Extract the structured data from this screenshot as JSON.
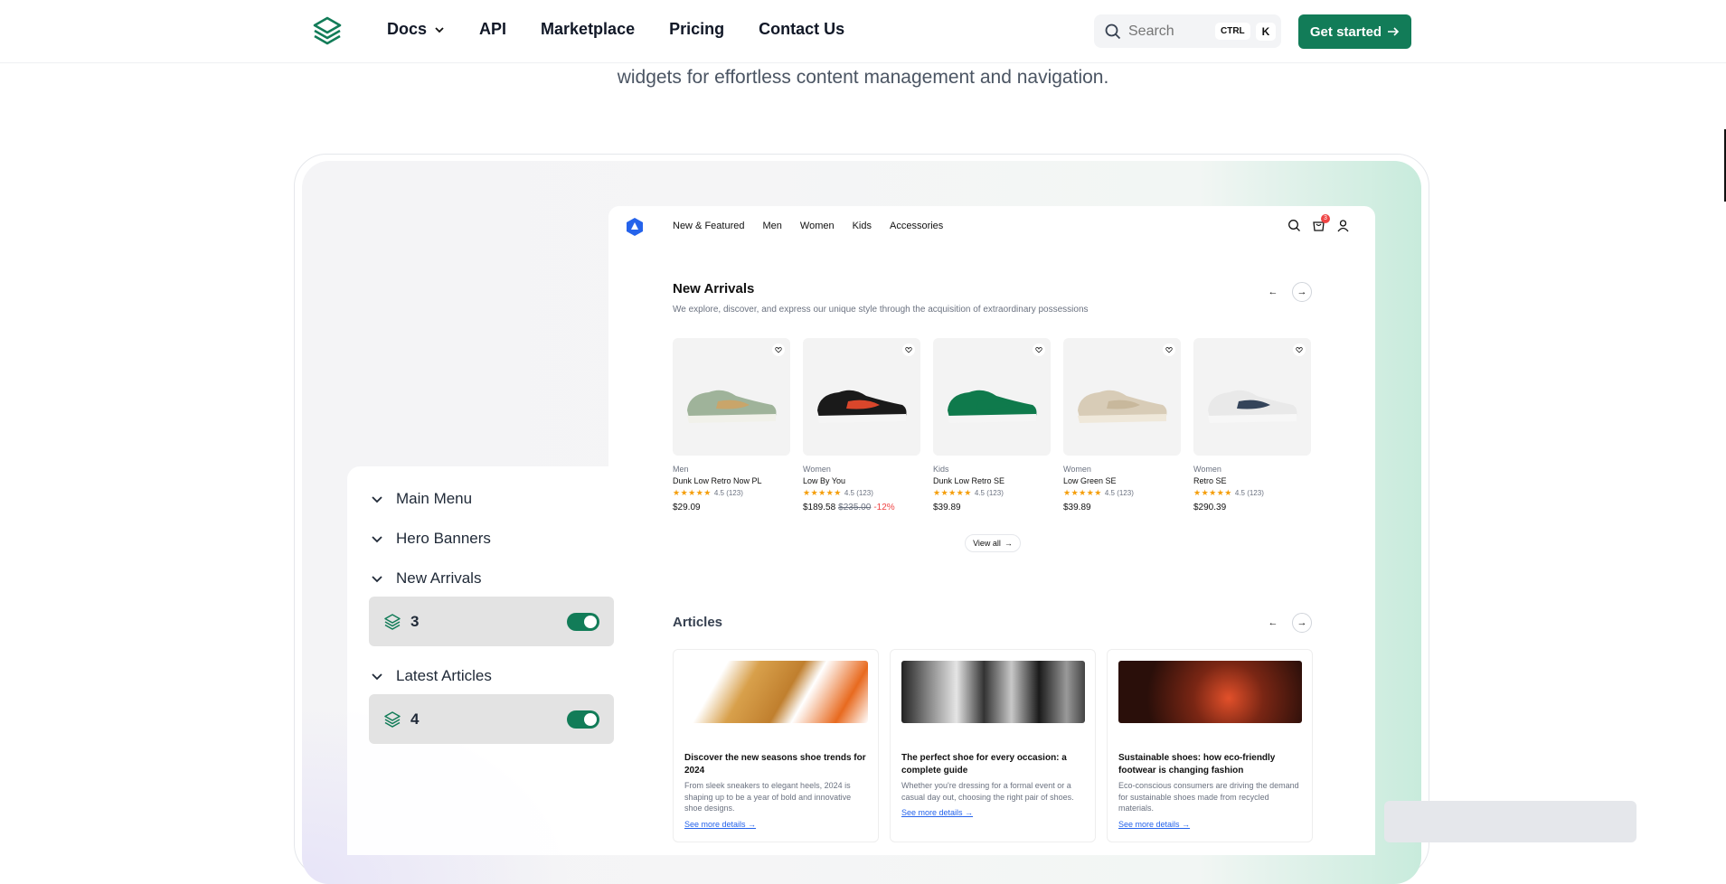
{
  "nav": {
    "links": [
      "Docs",
      "API",
      "Marketplace",
      "Pricing",
      "Contact Us"
    ],
    "search_placeholder": "Search",
    "kbd_ctrl": "CTRL",
    "kbd_k": "K",
    "cta": "Get started"
  },
  "hero": {
    "subtitle": "widgets for effortless content management and navigation."
  },
  "shop": {
    "nav": [
      "New & Featured",
      "Men",
      "Women",
      "Kids",
      "Accessories"
    ],
    "cart_count": "3",
    "new_arrivals": {
      "title": "New Arrivals",
      "subtitle": "We explore, discover, and express our unique style through the acquisition of extraordinary possessions",
      "view_all": "View all",
      "products": [
        {
          "category": "Men",
          "name": "Dunk Low Retro Now PL",
          "rating": "4.5 (123)",
          "price": "$29.09",
          "old_price": "",
          "discount": "",
          "colors": [
            "#9fb39a",
            "#f1f1ea",
            "#c9a56a"
          ]
        },
        {
          "category": "Women",
          "name": "Low By You",
          "rating": "4.5 (123)",
          "price": "$189.58",
          "old_price": "$235.00",
          "discount": "-12%",
          "colors": [
            "#1a1a1a",
            "#f5f5f5",
            "#d9462b"
          ]
        },
        {
          "category": "Kids",
          "name": "Dunk Low Retro SE",
          "rating": "4.5 (123)",
          "price": "$39.89",
          "old_price": "",
          "discount": "",
          "colors": [
            "#0f7a4c",
            "#f5f5f5",
            "#0f7a4c"
          ]
        },
        {
          "category": "Women",
          "name": "Low Green SE",
          "rating": "4.5 (123)",
          "price": "$39.89",
          "old_price": "",
          "discount": "",
          "colors": [
            "#d8ccb7",
            "#efe8da",
            "#c8b89c"
          ]
        },
        {
          "category": "Women",
          "name": "Retro SE",
          "rating": "4.5 (123)",
          "price": "$290.39",
          "old_price": "",
          "discount": "",
          "colors": [
            "#e9e9e9",
            "#f7f7f7",
            "#34445a"
          ]
        }
      ]
    },
    "articles": {
      "title": "Articles",
      "items": [
        {
          "title": "Discover the new seasons shoe trends for 2024",
          "text": "From sleek sneakers to elegant heels, 2024 is shaping up to be a year of bold and innovative shoe designs.",
          "link": "See more details",
          "img_color": "#d8a04b"
        },
        {
          "title": "The perfect shoe for every occasion: a complete guide",
          "text": "Whether you're dressing for a formal event or a casual day out, choosing the right pair of shoes.",
          "link": "See more details",
          "img_color": "#3a3a3a"
        },
        {
          "title": "Sustainable shoes: how eco-friendly footwear is changing fashion",
          "text": "Eco-conscious consumers are driving the demand for sustainable shoes made from recycled materials.",
          "link": "See more details",
          "img_color": "#5a1d12"
        }
      ]
    }
  },
  "panel": {
    "main_menu": "Main Menu",
    "hero_banners": "Hero Banners",
    "new_arrivals": "New Arrivals",
    "new_arrivals_count": "3",
    "latest_articles": "Latest Articles",
    "latest_articles_count": "4"
  },
  "accent_color": "#127c58"
}
